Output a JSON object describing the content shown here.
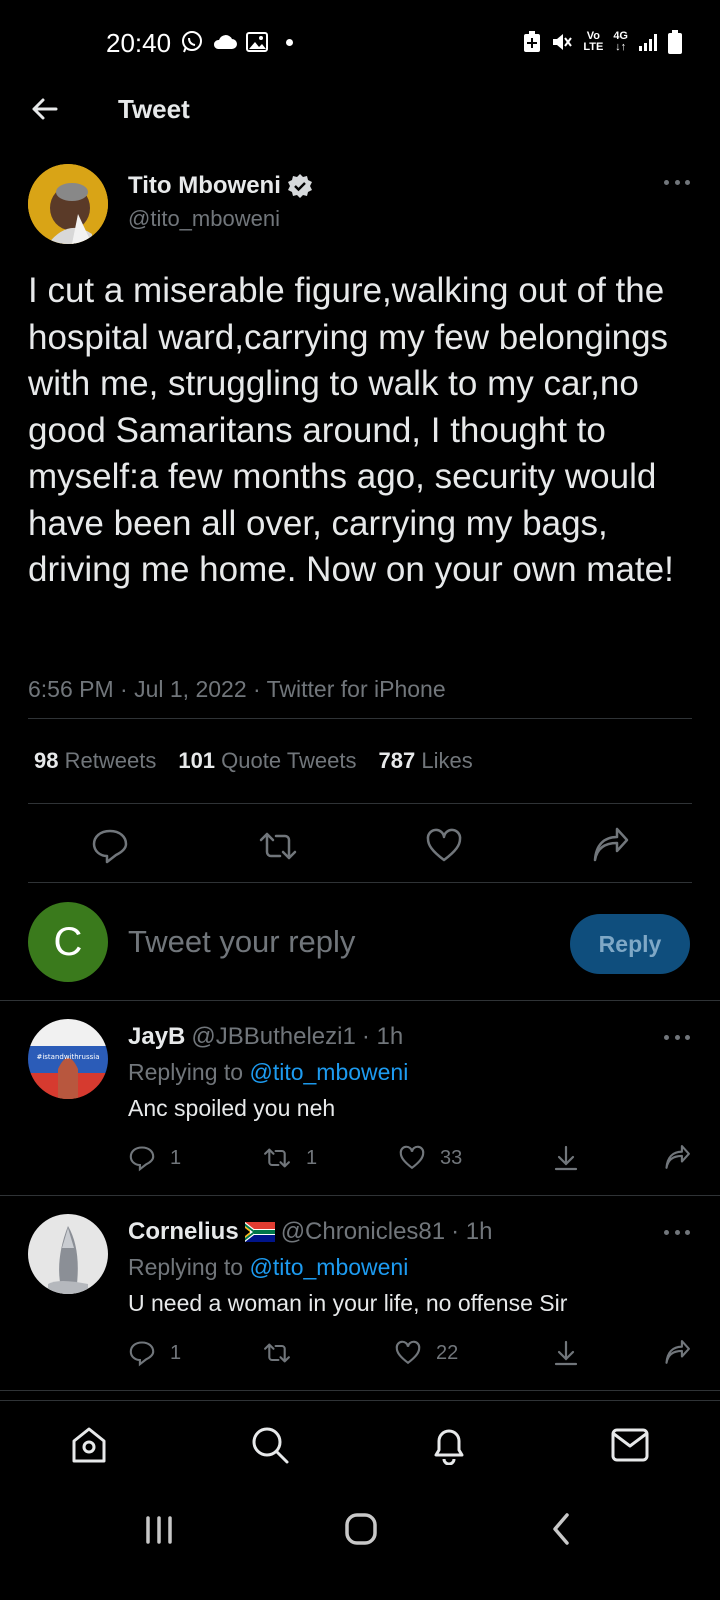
{
  "status_bar": {
    "time": "20:40",
    "volte": "Vo\nLTE",
    "network": "4G"
  },
  "header": {
    "title": "Tweet"
  },
  "tweet": {
    "author_name": "Tito Mboweni",
    "author_handle": "@tito_mboweni",
    "verified": true,
    "text": "I cut a miserable figure,walking out of the hospital ward,carrying my few belongings with me, struggling to walk to my car,no good Samaritans around, I thought to myself:a few months ago, security would have been all over, carrying my bags, driving me home. Now on your own mate!",
    "meta": "6:56 PM · Jul 1, 2022 · Twitter for iPhone",
    "stats": {
      "retweets_count": "98",
      "retweets_label": "Retweets",
      "quotes_count": "101",
      "quotes_label": "Quote Tweets",
      "likes_count": "787",
      "likes_label": "Likes"
    }
  },
  "compose": {
    "avatar_letter": "C",
    "placeholder": "Tweet your reply",
    "button_label": "Reply"
  },
  "replies": [
    {
      "name": "JayB",
      "handle": "@JBButhelezi1",
      "time": "· 1h",
      "replying_prefix": "Replying to",
      "replying_to": "@tito_mboweni",
      "text": "Anc spoiled you neh",
      "avatar_text": "#istandwithrussia",
      "reply_count": "1",
      "retweet_count": "1",
      "like_count": "33"
    },
    {
      "name": "Cornelius",
      "flag": "🇿🇦",
      "handle": "@Chronicles81",
      "time": "· 1h",
      "replying_prefix": "Replying to",
      "replying_to": "@tito_mboweni",
      "text": "U need a woman in your life, no offense Sir",
      "reply_count": "1",
      "retweet_count": "",
      "like_count": "22"
    }
  ],
  "colors": {
    "background": "#000000",
    "text": "#e7e9ea",
    "muted": "#71767b",
    "accent": "#1d9bf0",
    "divider": "#2f3336",
    "reply_button": "#0f4e7d"
  },
  "bottom_nav": {
    "items": [
      "home-icon",
      "search-icon",
      "notifications-icon",
      "messages-icon"
    ]
  }
}
